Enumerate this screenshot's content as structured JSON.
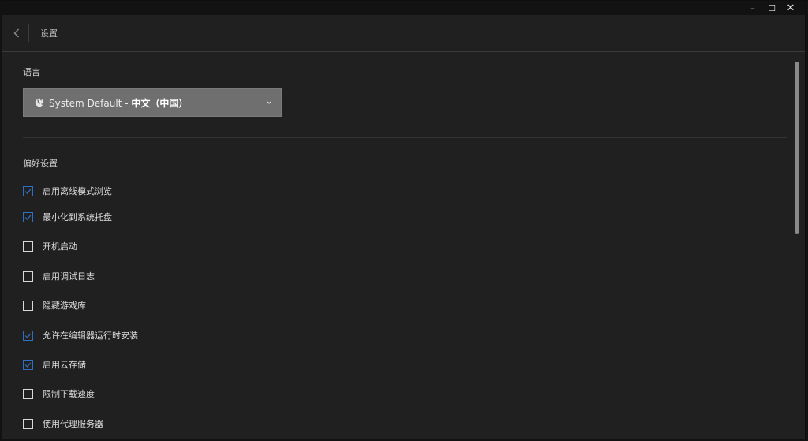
{
  "window": {
    "controls": {
      "minimize": "–",
      "maximize": "☐",
      "close": "✕"
    }
  },
  "header": {
    "back_icon": "chevron-left-icon",
    "title": "设置"
  },
  "language": {
    "label": "语言",
    "selected_prefix": "System Default",
    "selected_separator": " - ",
    "selected_native": "中文（中国）",
    "icon": "globe-icon",
    "dropdown_icon": "chevron-down-icon"
  },
  "preferences": {
    "label": "偏好设置",
    "items": [
      {
        "label": "启用离线模式浏览",
        "checked": true
      },
      {
        "label": "最小化到系统托盘",
        "checked": true
      },
      {
        "label": "开机启动",
        "checked": false
      },
      {
        "label": "启用调试日志",
        "checked": false
      },
      {
        "label": "隐藏游戏库",
        "checked": false
      },
      {
        "label": "允许在编辑器运行时安装",
        "checked": true
      },
      {
        "label": "启用云存储",
        "checked": true
      },
      {
        "label": "限制下载速度",
        "checked": false
      },
      {
        "label": "使用代理服务器",
        "checked": false
      }
    ]
  },
  "colors": {
    "accent": "#2f6fc4",
    "background": "#202020",
    "dropdown": "#6f6f6f"
  }
}
